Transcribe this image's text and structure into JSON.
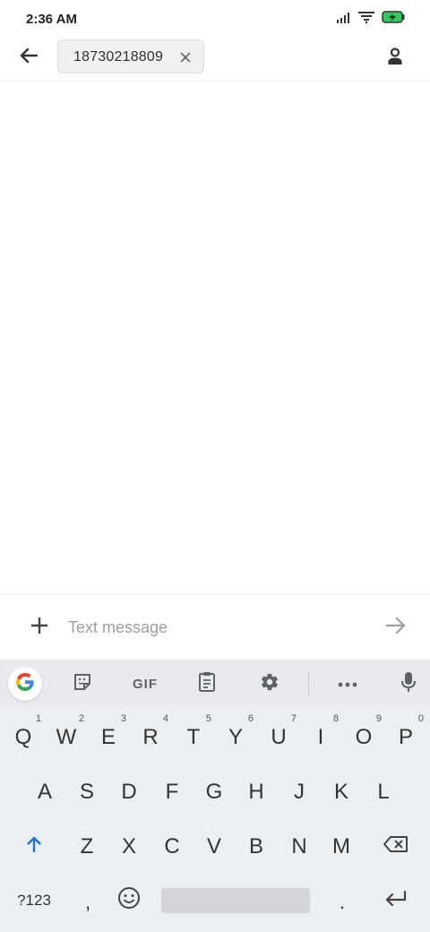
{
  "status_bar": {
    "time": "2:36 AM",
    "battery_color": "#34c759"
  },
  "top_bar": {
    "back_icon": "arrow-back-icon",
    "recipient": "18730218809",
    "remove_icon": "close-icon",
    "contact_icon": "person-icon"
  },
  "compose": {
    "add_icon": "plus-icon",
    "placeholder": "Text message",
    "value": "",
    "send_icon": "send-arrow-icon"
  },
  "keyboard": {
    "toolbar": [
      "google-icon",
      "sticker-icon",
      "GIF",
      "clipboard-icon",
      "gear-icon",
      "more-icon",
      "mic-icon"
    ],
    "row1": [
      {
        "key": "Q",
        "hint": "1"
      },
      {
        "key": "W",
        "hint": "2"
      },
      {
        "key": "E",
        "hint": "3"
      },
      {
        "key": "R",
        "hint": "4"
      },
      {
        "key": "T",
        "hint": "5"
      },
      {
        "key": "Y",
        "hint": "6"
      },
      {
        "key": "U",
        "hint": "7"
      },
      {
        "key": "I",
        "hint": "8"
      },
      {
        "key": "O",
        "hint": "9"
      },
      {
        "key": "P",
        "hint": "0"
      }
    ],
    "row2": [
      "A",
      "S",
      "D",
      "F",
      "G",
      "H",
      "J",
      "K",
      "L"
    ],
    "row3": [
      "Z",
      "X",
      "C",
      "V",
      "B",
      "N",
      "M"
    ],
    "row4": {
      "symbols": "?123",
      "comma": ",",
      "period": "."
    },
    "accent_color": "#1a73e8"
  }
}
